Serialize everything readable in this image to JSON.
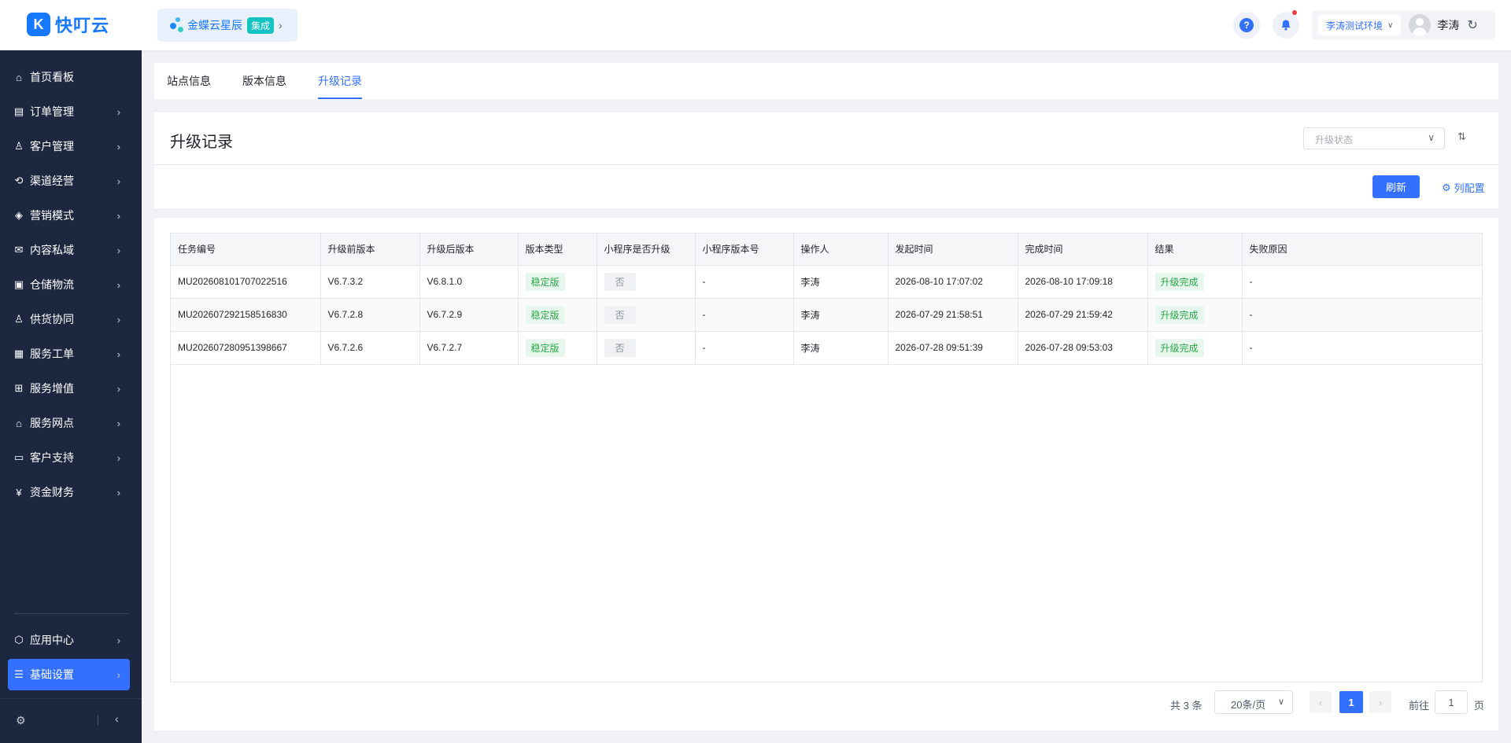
{
  "header": {
    "logo_text": "快叮云",
    "product_name": "金蝶云星辰",
    "product_badge": "集成",
    "environment": "李涛测试环境",
    "user_name": "李涛"
  },
  "sidebar": {
    "items": [
      {
        "label": "首页看板",
        "icon": "home-icon"
      },
      {
        "label": "订单管理",
        "icon": "order-icon"
      },
      {
        "label": "客户管理",
        "icon": "customer-icon"
      },
      {
        "label": "渠道经营",
        "icon": "channel-icon"
      },
      {
        "label": "营销模式",
        "icon": "marketing-icon"
      },
      {
        "label": "内容私域",
        "icon": "content-icon"
      },
      {
        "label": "仓储物流",
        "icon": "warehouse-icon"
      },
      {
        "label": "供货协同",
        "icon": "supply-icon"
      },
      {
        "label": "服务工单",
        "icon": "workorder-icon"
      },
      {
        "label": "服务增值",
        "icon": "value-added-icon"
      },
      {
        "label": "服务网点",
        "icon": "service-point-icon"
      },
      {
        "label": "客户支持",
        "icon": "support-icon"
      },
      {
        "label": "资金财务",
        "icon": "finance-icon"
      }
    ],
    "bottom_items": [
      {
        "label": "应用中心",
        "icon": "app-center-icon"
      },
      {
        "label": "基础设置",
        "icon": "settings-icon",
        "active": true
      }
    ]
  },
  "tabs": [
    {
      "label": "站点信息"
    },
    {
      "label": "版本信息"
    },
    {
      "label": "升级记录",
      "active": true
    }
  ],
  "page": {
    "title": "升级记录",
    "status_filter_placeholder": "升级状态",
    "refresh_label": "刷新",
    "column_config_label": "列配置"
  },
  "table": {
    "columns": [
      "任务编号",
      "升级前版本",
      "升级后版本",
      "版本类型",
      "小程序是否升级",
      "小程序版本号",
      "操作人",
      "发起时间",
      "完成时间",
      "结果",
      "失败原因"
    ],
    "rows": [
      {
        "task_id": "MU202608101707022516",
        "from_version": "V6.7.3.2",
        "to_version": "V6.8.1.0",
        "version_type": "稳定版",
        "mini_upgrade": "否",
        "mini_version": "-",
        "operator": "李涛",
        "start_time": "2026-08-10 17:07:02",
        "end_time": "2026-08-10 17:09:18",
        "result": "升级完成",
        "fail_reason": "-"
      },
      {
        "task_id": "MU202607292158516830",
        "from_version": "V6.7.2.8",
        "to_version": "V6.7.2.9",
        "version_type": "稳定版",
        "mini_upgrade": "否",
        "mini_version": "-",
        "operator": "李涛",
        "start_time": "2026-07-29 21:58:51",
        "end_time": "2026-07-29 21:59:42",
        "result": "升级完成",
        "fail_reason": "-"
      },
      {
        "task_id": "MU202607280951398667",
        "from_version": "V6.7.2.6",
        "to_version": "V6.7.2.7",
        "version_type": "稳定版",
        "mini_upgrade": "否",
        "mini_version": "-",
        "operator": "李涛",
        "start_time": "2026-07-28 09:51:39",
        "end_time": "2026-07-28 09:53:03",
        "result": "升级完成",
        "fail_reason": "-"
      }
    ]
  },
  "pagination": {
    "total_text": "共 3 条",
    "page_size": "20条/页",
    "current_page": "1",
    "goto_label": "前往",
    "goto_value": "1",
    "page_unit": "页"
  },
  "colors": {
    "primary": "#3370ff",
    "sidebar_bg": "#1d2840",
    "success_tag_bg": "#e8f7ee",
    "success_tag_text": "#28a745"
  }
}
